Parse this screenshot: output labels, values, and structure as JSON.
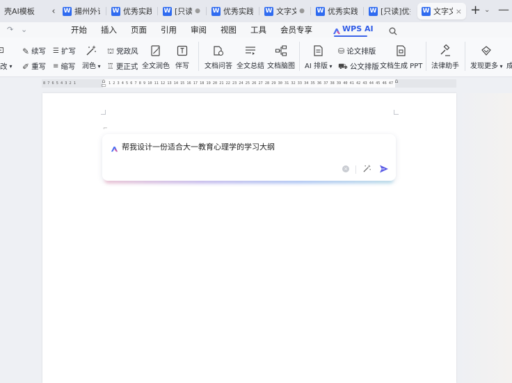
{
  "tabs": [
    {
      "label": "壳AI模板",
      "type": "template"
    },
    {
      "label": "揚州外语",
      "type": "doc"
    },
    {
      "label": "优秀实践",
      "type": "doc"
    },
    {
      "label": "[只读]",
      "type": "doc",
      "indicator": "●"
    },
    {
      "label": "优秀实践",
      "type": "doc"
    },
    {
      "label": "文字文",
      "type": "doc",
      "indicator": "●"
    },
    {
      "label": "优秀实践",
      "type": "doc"
    },
    {
      "label": "[只读]优秀",
      "type": "doc"
    },
    {
      "label": "文字文",
      "type": "doc",
      "active": true,
      "close": "×"
    }
  ],
  "tabbar": {
    "back": "‹",
    "plus": "+",
    "caret": "⌄",
    "minimize": "—"
  },
  "menu": {
    "items": [
      "开始",
      "插入",
      "页面",
      "引用",
      "审阅",
      "视图",
      "工具",
      "会员专享"
    ],
    "wps_ai": "WPS AI",
    "search_icon": "search-icon"
  },
  "ribbon": {
    "left_cut": [
      "改",
      "改"
    ],
    "small": [
      {
        "label": "续写",
        "icon": "pen-icon"
      },
      {
        "label": "扩写",
        "icon": "expand-lines-icon"
      },
      {
        "label": "重写",
        "icon": "rewrite-icon"
      },
      {
        "label": "缩写",
        "icon": "shrink-lines-icon"
      },
      {
        "label": "党政风",
        "icon": "party-style-icon"
      },
      {
        "label": "更正式",
        "icon": "formal-icon"
      },
      {
        "label": "论文排版",
        "icon": "paper-layout-icon"
      },
      {
        "label": "公文排版",
        "icon": "official-layout-icon"
      }
    ],
    "magic": "润色",
    "big": [
      {
        "label": "全文润色",
        "icon": "full-polish-icon"
      },
      {
        "label": "伴写",
        "icon": "companion-write-icon"
      },
      {
        "label": "文档问答",
        "icon": "doc-qa-icon"
      },
      {
        "label": "全文总结",
        "icon": "summary-icon"
      },
      {
        "label": "文档脑图",
        "icon": "mindmap-icon"
      },
      {
        "label": "AI 排版",
        "icon": "ai-layout-icon"
      },
      {
        "label": "文档生成 PPT",
        "icon": "doc-to-ppt-icon"
      },
      {
        "label": "法律助手",
        "icon": "law-hammer-icon"
      },
      {
        "label": "发现更多",
        "icon": "discover-icon"
      },
      {
        "label": "成",
        "icon": "cut-icon"
      }
    ]
  },
  "ruler": {
    "left_numbers": "8 7 6 5 4 3 2 1",
    "right_numbers": "1 2 3 4 5 6 7 8 9 10 11 12 13 14 15 16 17 18 19 20 21 22 23 24 25 26 27 28 29 30 31 32 33 34 35 36 37 38 39 40 41 42 43 44 45 46 47"
  },
  "prompt": {
    "text": "帮我设计一份适合大一教育心理学的学习大纲",
    "clear": "×",
    "magic": "✨"
  },
  "colors": {
    "accent": "#3b63e8",
    "word_blue": "#2f6bf0",
    "send": "#5b5ce6"
  }
}
